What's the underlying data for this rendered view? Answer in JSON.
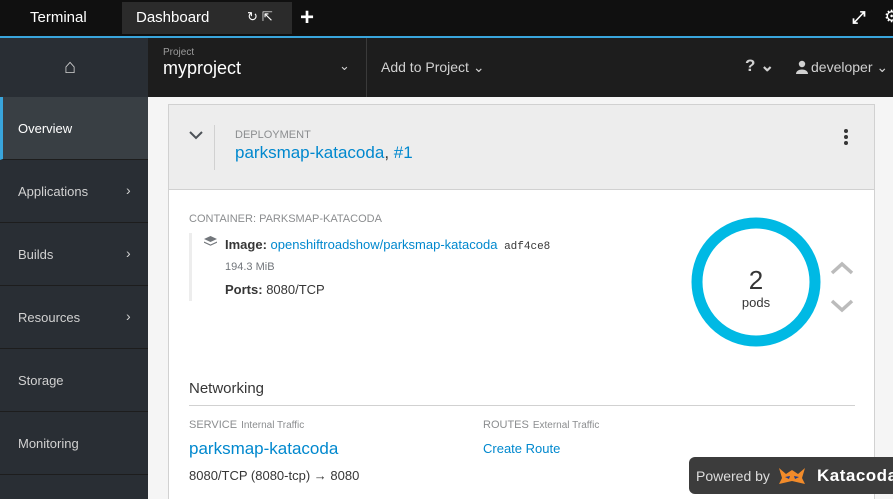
{
  "tabs": {
    "terminal": "Terminal",
    "dashboard": "Dashboard",
    "refresh_icon": "↻",
    "open_icon": "⇱",
    "add_icon": "+"
  },
  "header": {
    "home_icon": "⌂",
    "project_label": "Project",
    "project_name": "myproject",
    "project_chevron": "⌄",
    "add_to_project": "Add to Project ⌄",
    "help_icon": "? ⌄",
    "user": "developer ⌄",
    "expand_icon": "⤢",
    "settings_icon": "⚙"
  },
  "sidebar": {
    "items": [
      {
        "label": "Overview",
        "has_chevron": false
      },
      {
        "label": "Applications",
        "has_chevron": true
      },
      {
        "label": "Builds",
        "has_chevron": true
      },
      {
        "label": "Resources",
        "has_chevron": true
      },
      {
        "label": "Storage",
        "has_chevron": false
      },
      {
        "label": "Monitoring",
        "has_chevron": false
      }
    ],
    "chevron": "›"
  },
  "deployment": {
    "label": "DEPLOYMENT",
    "name": "parksmap-katacoda",
    "revision": "#1",
    "container_label": "CONTAINER: PARKSMAP-KATACODA",
    "image_label": "Image:",
    "image_name": "openshiftroadshow/parksmap-katacoda",
    "image_hash": "adf4ce8",
    "image_size": "194.3 MiB",
    "ports_label": "Ports:",
    "ports_value": "8080/TCP",
    "pod_count": "2",
    "pod_label": "pods",
    "donut_color": "#00b9e4"
  },
  "networking": {
    "title": "Networking",
    "service_label": "SERVICE",
    "service_sub": "Internal Traffic",
    "service_name": "parksmap-katacoda",
    "service_ports": "8080/TCP (8080-tcp) → 8080",
    "routes_label": "ROUTES",
    "routes_sub": "External Traffic",
    "create_route": "Create Route"
  },
  "badge": {
    "powered_by": "Powered by",
    "brand": "Katacoda"
  }
}
